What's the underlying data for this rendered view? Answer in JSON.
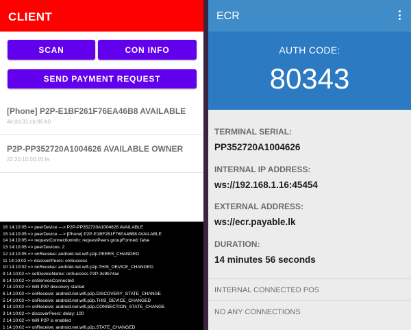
{
  "client": {
    "title": "CLIENT",
    "colors": {
      "toolbar": "#ff0000",
      "button": "#6200ee"
    },
    "buttons": {
      "scan": "SCAN",
      "con_info": "CON INFO",
      "send_payment": "SEND PAYMENT REQUEST"
    },
    "peers": [
      {
        "name": "[Phone] P2P-E1BF261F76EA46B8 AVAILABLE",
        "mac": "4e:dd:31:cb:96:b0"
      },
      {
        "name": "P2P-PP352720A1004626 AVAILABLE OWNER",
        "mac": "22:20:10:00:15:fa"
      }
    ],
    "log": [
      "16 14:10:05 => peerDevice ---> P2P-PP352720A1004626 AVAILABLE",
      "15 14:10:05 => peerDevice ---> [Phone] P2P-E1BF261F76EA46B8 AVAILABLE",
      "14 14:10:05 => requestConnectionInfo: requestPeers  groupFormed: false",
      "13 14:10:05 => peerDevices: 2",
      "12 14:10:05 => onReceive: android.net.wifi.p2p.PEERS_CHANGED",
      "11 14:10:02 => discoverPeers: onSuccess",
      "10 14:10:02 => onReceive: android.net.wifi.p2p.THIS_DEVICE_CHANGED",
      "9 14:10:02 => setDeviceName: onSuccess P2P-3c9b74ac",
      "8 14:10:02 => onServiceConnected",
      "7 14:10:02 => Wifi P2P discovery started",
      "6 14:10:02 => onReceive: android.net.wifi.p2p.DISCOVERY_STATE_CHANGE",
      "5 14:10:02 => onReceive: android.net.wifi.p2p.THIS_DEVICE_CHANGED",
      "4 14:10:02 => onReceive: android.net.wifi.p2p.CONNECTION_STATE_CHANGE",
      "3 14:10:02 => discoverPeers: delay: 100",
      "2 14:10:02 => Wifi P2P is enabled",
      "1 14:10:02 => onReceive: android.net.wifi.p2p.STATE_CHANGED"
    ]
  },
  "ecr": {
    "title": "ECR",
    "colors": {
      "toolbar": "#3f8cc8",
      "auth_panel": "#2b7ac2"
    },
    "menu_icon": "more-vert-icon",
    "auth_label": "AUTH CODE:",
    "auth_code": "80343",
    "fields": [
      {
        "label": "TERMINAL SERIAL:",
        "value": "PP352720A1004626"
      },
      {
        "label": "INTERNAL IP ADDRESS:",
        "value": "ws://192.168.1.16:45454"
      },
      {
        "label": "EXTERNAL ADDRESS:",
        "value": "ws://ecr.payable.lk"
      },
      {
        "label": "DURATION:",
        "value": "14 minutes 56 seconds"
      }
    ],
    "connected_header": "INTERNAL CONNECTED POS",
    "no_connections": "NO ANY CONNECTIONS"
  }
}
